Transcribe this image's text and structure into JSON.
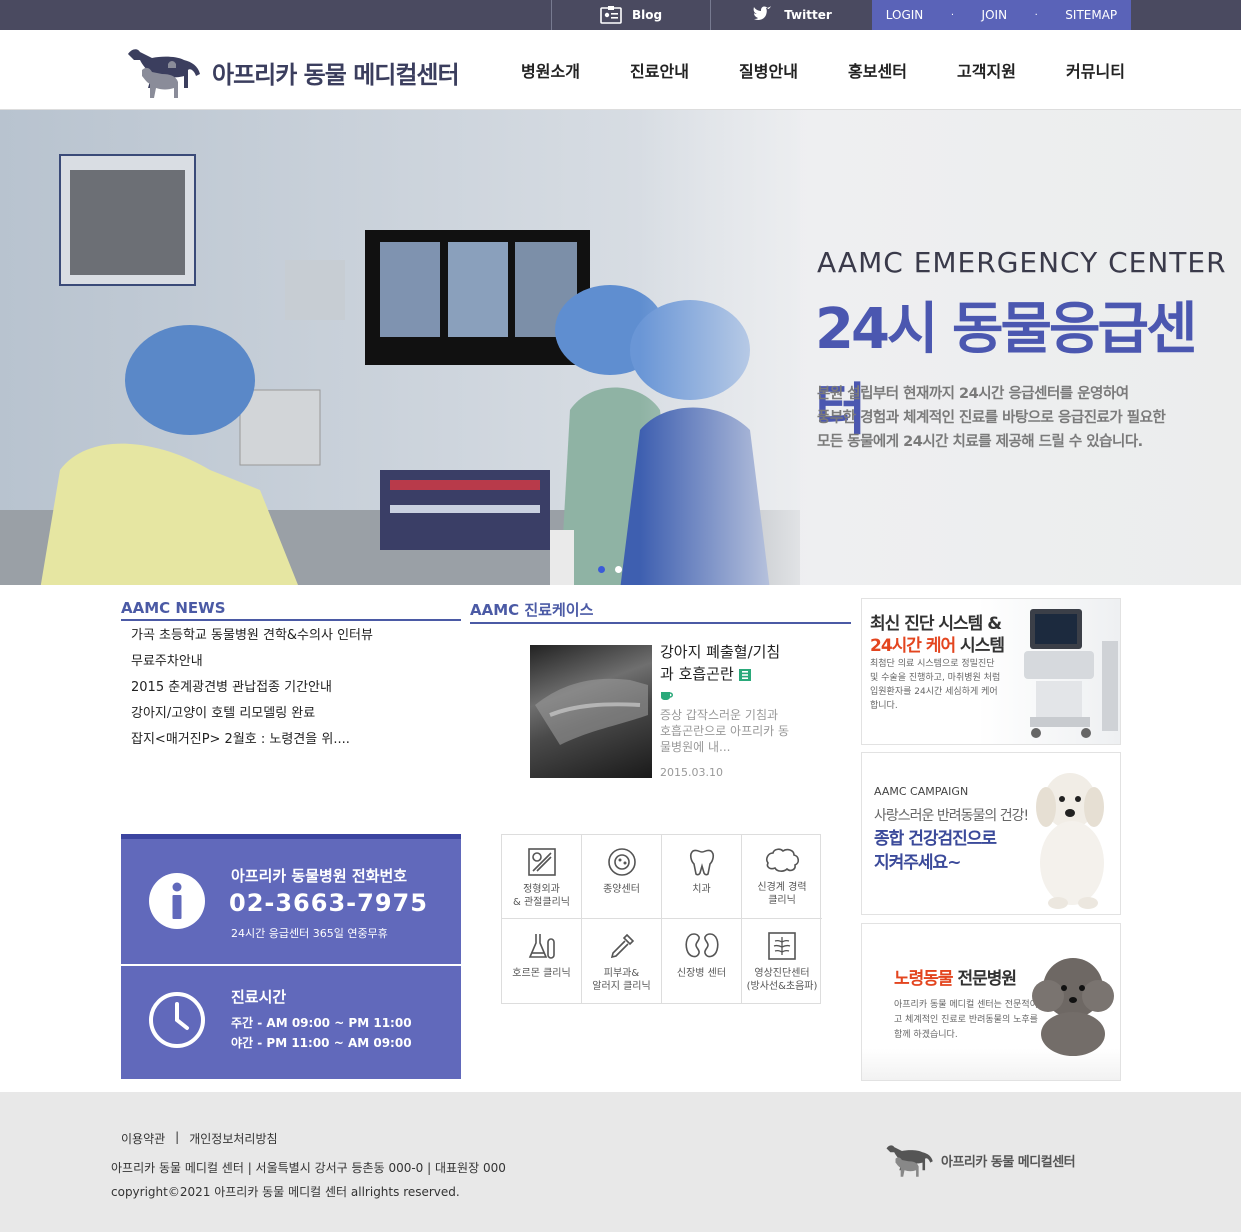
{
  "topbar": {
    "blog": "Blog",
    "twitter": "Twitter",
    "login": "LOGIN",
    "join": "JOIN",
    "sitemap": "SITEMAP",
    "dot": "·"
  },
  "header": {
    "logo_text": "아프리카 동물 메디컬센터",
    "nav": [
      "병원소개",
      "진료안내",
      "질병안내",
      "홍보센터",
      "고객지원",
      "커뮤니티"
    ]
  },
  "hero": {
    "subtitle": "AAMC EMERGENCY CENTER",
    "title": "24시 동물응급센터",
    "desc": [
      "본원 설립부터 현재까지 24시간 응급센터를 운영하여",
      "풍부한 경험과 체계적인 진료를 바탕으로 응급진료가 필요한",
      "모든 동물에게 24시간 치료를 제공해 드릴 수 있습니다."
    ]
  },
  "news": {
    "title": "AAMC NEWS",
    "items": [
      "가곡 초등학교 동물병원 견학&수의사 인터뷰",
      "무료주차안내",
      "2015 춘계광견병 관납접종 기간안내",
      "강아지/고양이 호텔 리모델링 완료",
      "잡지<매거진P> 2월호 : 노령견을 위...."
    ]
  },
  "cases": {
    "title": "AAMC 진료케이스",
    "name": "강아지 폐출혈/기침과 호흡곤란",
    "desc": "증상 갑작스러운 기침과 호흡곤란으로 아프리카 동물병원에 내...",
    "date": "2015.03.10"
  },
  "banners": {
    "b1_line1": "최신 진단 시스템 &",
    "b1_line2_em": "24시간 케어",
    "b1_line2_rest": " 시스템",
    "b1_desc": "최첨단 의료 시스템으로 정밀진단 및 수술을 진행하고, 마취병원 처럼 입원환자를 24시간 세심하게 케어 합니다.",
    "b2_line1": "AAMC CAMPAIGN",
    "b2_line2": "사랑스러운 반려동물의 건강!",
    "b2_line3": "종합 건강검진으로",
    "b2_line4": "지켜주세요~",
    "b3_em": "노령동물",
    "b3_rest": " 전문병원",
    "b3_desc": "아프리카 동물 메디컬 센터는 전문적이고 체계적인 진료로 반려동물의 노후를 함께 하겠습니다."
  },
  "info": {
    "phone_label": "아프리카 동물병원 전화번호",
    "phone": "02-3663-7975",
    "phone_sub": "24시간 응급센터 365일 연중무휴",
    "hours_label": "진료시간",
    "hours_day": "주간 - AM 09:00 ~ PM 11:00",
    "hours_night": "야간 - PM 11:00 ~ AM 09:00"
  },
  "clinics": [
    {
      "label": "정형외과\n& 관절클리닉",
      "icon": "bone-joint-icon"
    },
    {
      "label": "종양센터",
      "icon": "cell-icon"
    },
    {
      "label": "치과",
      "icon": "tooth-icon"
    },
    {
      "label": "신경계 경력\n클리닉",
      "icon": "brain-icon"
    },
    {
      "label": "호르몬 클리닉",
      "icon": "flask-icon"
    },
    {
      "label": "피부과&\n알러지 클리닉",
      "icon": "dropper-icon"
    },
    {
      "label": "신장병 센터",
      "icon": "kidney-icon"
    },
    {
      "label": "영상진단센터\n(방사선&초음파)",
      "icon": "xray-icon"
    }
  ],
  "footer": {
    "terms": "이용약관",
    "privacy": "개인정보처리방침",
    "address": "아프리카 동물 메디컬 센터 | 서울특별시 강서구 등촌동 000-0 | 대표원장 000",
    "copyright": "copyright©2021 아프리카 동물 메디컬 센터 allrights reserved.",
    "logo_text": "아프리카 동물 메디컬센터"
  },
  "colors": {
    "brand": "#4b57b0",
    "topbar": "#4a4a60",
    "accent_orange": "#e3451f"
  }
}
